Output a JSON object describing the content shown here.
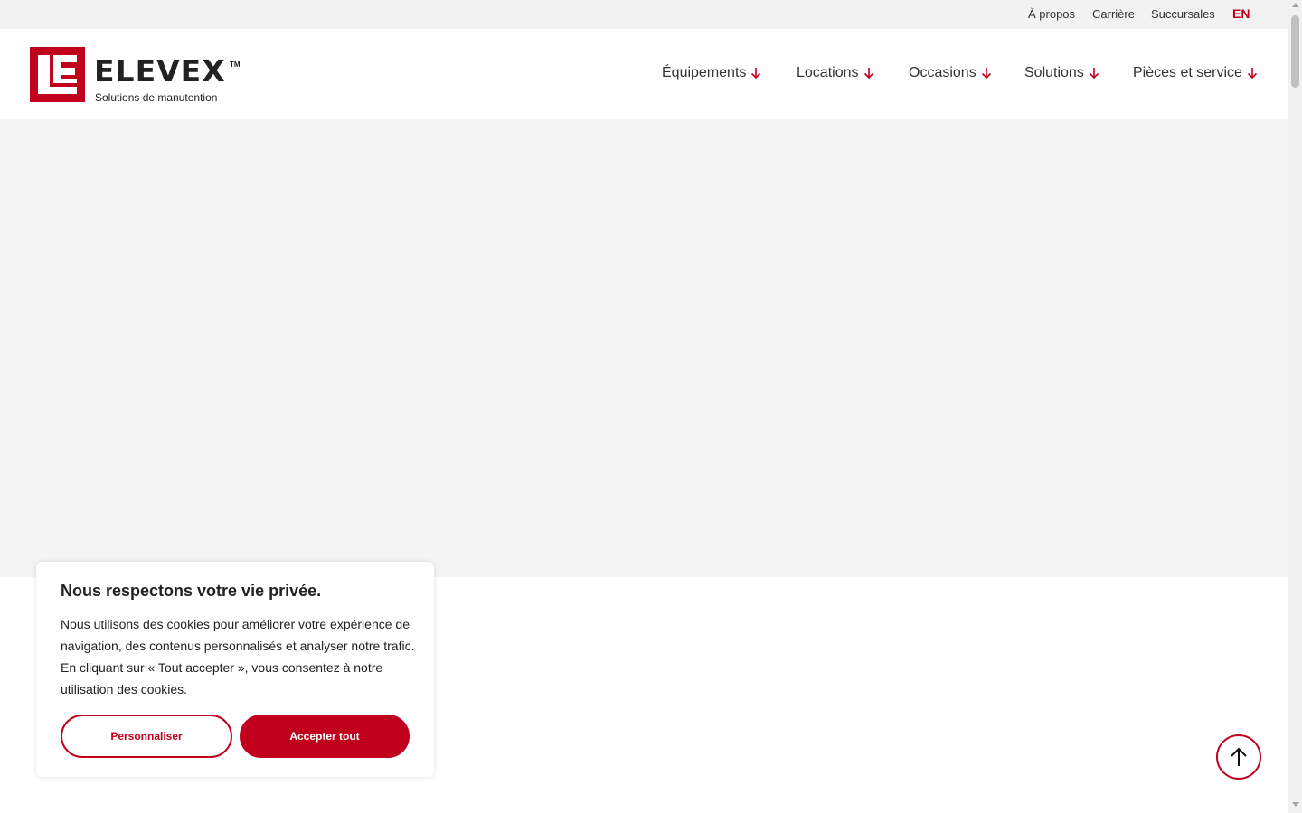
{
  "topbar": {
    "links": [
      "À propos",
      "Carrière",
      "Succursales"
    ],
    "language": "EN"
  },
  "brand": {
    "name": "ELEVEX",
    "trademark": "TM",
    "tagline": "Solutions de manutention",
    "accent_color": "#c0001d"
  },
  "nav": {
    "items": [
      {
        "label": "Équipements",
        "icon": "arrow-down-icon"
      },
      {
        "label": "Locations",
        "icon": "arrow-down-icon"
      },
      {
        "label": "Occasions",
        "icon": "arrow-down-icon"
      },
      {
        "label": "Solutions",
        "icon": "arrow-down-icon"
      },
      {
        "label": "Pièces et service",
        "icon": "arrow-down-icon"
      }
    ]
  },
  "cookie": {
    "title": "Nous respectons votre vie privée.",
    "text": "Nous utilisons des cookies pour améliorer votre expérience de navigation, des contenus personnalisés et analyser notre trafic. En cliquant sur « Tout accepter », vous consentez à notre utilisation des cookies.",
    "customize_label": "Personnaliser",
    "accept_label": "Accepter tout"
  },
  "back_to_top": {
    "icon": "arrow-up-icon"
  }
}
